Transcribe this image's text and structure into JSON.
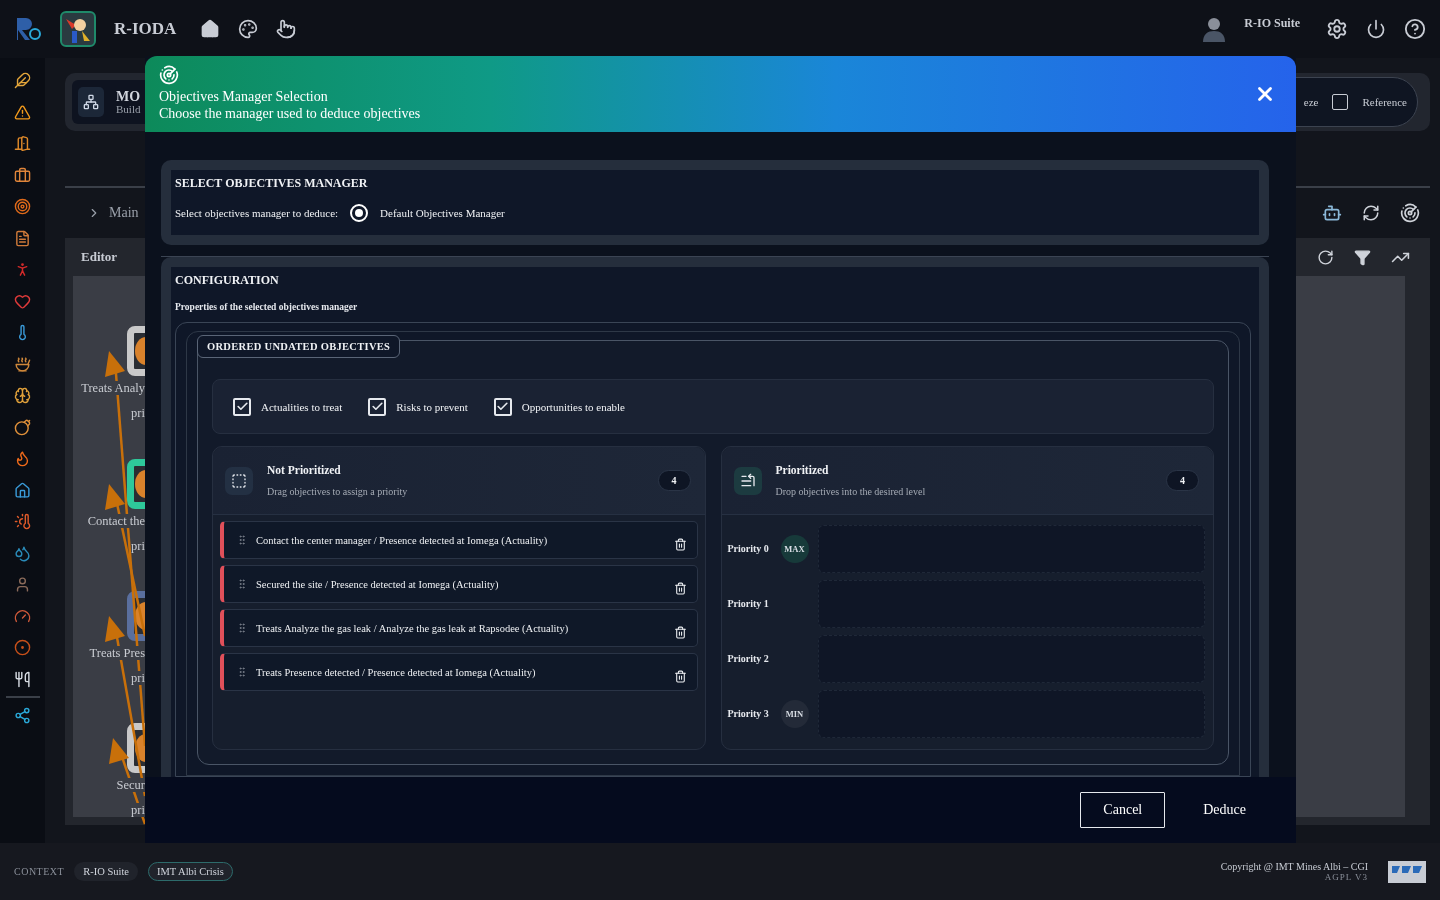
{
  "app": {
    "title": "R-IODA",
    "user": "R-IO Suite"
  },
  "background": {
    "card_title": "MO",
    "card_subtitle": "Build",
    "freeze_label": "eze",
    "reference": {
      "label": "Reference",
      "checked": false
    },
    "breadcrumb": "Main",
    "editor_title": "Editor",
    "nodes": [
      {
        "label": "Treats Analy",
        "sub": "pri",
        "color": "#c9c9c9"
      },
      {
        "label": "Contact the",
        "sub": "pri",
        "color": "#2ec89a"
      },
      {
        "label": "Treats Pres",
        "sub": "pri",
        "color": "#5a6f9e"
      },
      {
        "label": "Secur",
        "sub": "pri",
        "color": "#c9c9c9"
      }
    ]
  },
  "dialog": {
    "title": "Objectives Manager Selection",
    "subtitle": "Choose the manager used to deduce objectives",
    "select_section": {
      "heading": "SELECT OBJECTIVES MANAGER",
      "label": "Select objectives manager to deduce:",
      "options": [
        {
          "label": "Default Objectives Manager",
          "selected": true
        }
      ]
    },
    "config_section": {
      "heading": "CONFIGURATION",
      "description": "Properties of the selected objectives manager",
      "legend": "ORDERED UNDATED OBJECTIVES",
      "filters": [
        {
          "label": "Actualities to treat",
          "checked": true
        },
        {
          "label": "Risks to prevent",
          "checked": true
        },
        {
          "label": "Opportunities to enable",
          "checked": true
        }
      ],
      "not_prioritized": {
        "title": "Not Prioritized",
        "subtitle": "Drag objectives to assign a priority",
        "count": "4",
        "items": [
          {
            "text": "Contact the center manager / Presence detected at Iomega (Actuality)"
          },
          {
            "text": "Secured the site / Presence detected at Iomega (Actuality)"
          },
          {
            "text": "Treats Analyze the gas leak / Analyze the gas leak at Rapsodee (Actuality)"
          },
          {
            "text": "Treats Presence detected / Presence detected at Iomega (Actuality)"
          }
        ]
      },
      "prioritized": {
        "title": "Prioritized",
        "subtitle": "Drop objectives into the desired level",
        "count": "4",
        "levels": [
          {
            "label": "Priority 0",
            "badge": "MAX",
            "kind": "max"
          },
          {
            "label": "Priority 1",
            "kind": "plain"
          },
          {
            "label": "Priority 2",
            "kind": "plain"
          },
          {
            "label": "Priority 3",
            "badge": "MIN",
            "kind": "min"
          }
        ]
      }
    },
    "buttons": [
      {
        "label": "Cancel",
        "kind": "outlined"
      },
      {
        "label": "Deduce",
        "kind": "text"
      }
    ]
  },
  "footer": {
    "context_label": "CONTEXT",
    "chips": [
      {
        "label": "R-IO Suite",
        "selected": false
      },
      {
        "label": "IMT Albi Crisis",
        "selected": true
      }
    ],
    "copyright": "Copyright @ IMT Mines Albi – CGI",
    "license": "AGPL V3"
  }
}
